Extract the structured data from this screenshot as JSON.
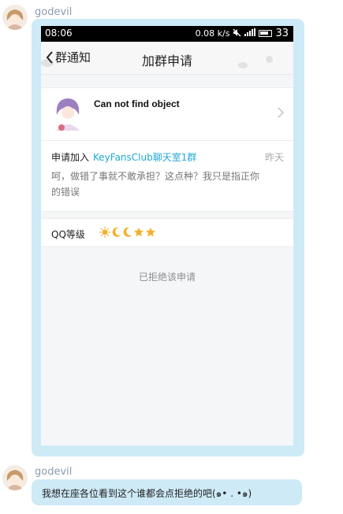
{
  "messages": [
    {
      "sender": "godevil"
    },
    {
      "sender": "godevil",
      "text": "我想在座各位看到这个谁都会点拒绝的吧(๑• . •๑)"
    }
  ],
  "phone": {
    "status_bar": {
      "time": "08:06",
      "speed": "0.08 k/s",
      "battery": "33"
    },
    "titlebar": {
      "back_label": "群通知",
      "title": "加群申请"
    },
    "user": {
      "name": "Can not find object"
    },
    "request": {
      "prefix": "申请加入",
      "group": "KeyFansClub聊天室1群",
      "time": "昨天",
      "message": "呵，做错了事就不敢承担？这点种？我只是指正你的错误"
    },
    "level": {
      "label": "QQ等级",
      "icons": [
        "sun-icon",
        "moon-icon",
        "moon-icon",
        "star-icon",
        "star-icon"
      ]
    },
    "status": "已拒绝该申请"
  },
  "colors": {
    "bubble": "#cdeaf6",
    "link": "#22a9d6",
    "level_icon": "#f1b12e"
  }
}
